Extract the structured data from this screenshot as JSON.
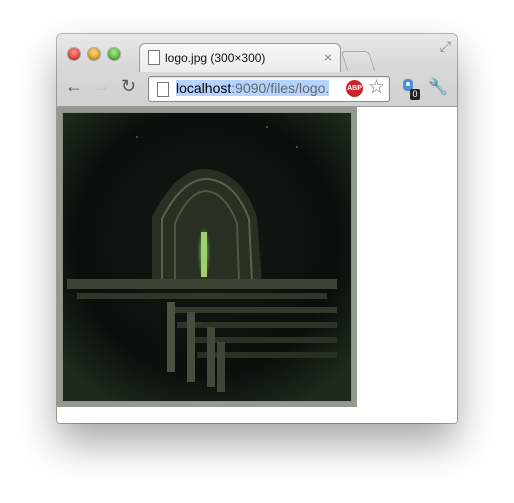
{
  "tab": {
    "title": "logo.jpg (300×300)",
    "close": "×"
  },
  "toolbar": {
    "url_host": "localhost",
    "url_path": ":9090/files/logo.",
    "adblock_label": "ABP",
    "extension_badge": "0"
  }
}
